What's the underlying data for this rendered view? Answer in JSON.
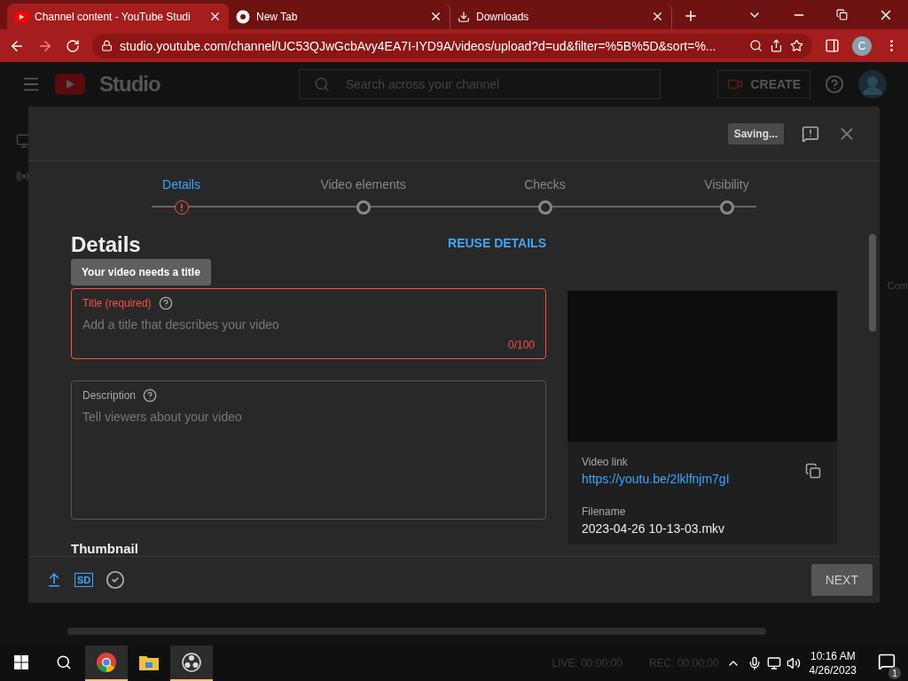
{
  "browser": {
    "tabs": [
      {
        "title": "Channel content - YouTube Studi",
        "selected": true
      },
      {
        "title": "New Tab",
        "selected": false
      },
      {
        "title": "Downloads",
        "selected": false
      }
    ],
    "url": "studio.youtube.com/channel/UC53QJwGcbAvy4EA7I-IYD9A/videos/upload?d=ud&filter=%5B%5D&sort=%...",
    "profile": "C"
  },
  "studio": {
    "logo": "Studio",
    "search_placeholder": "Search across your channel",
    "create": "CREATE",
    "side_text": "Com"
  },
  "dialog": {
    "saving": "Saving...",
    "steps": [
      {
        "label": "Details",
        "selected": true,
        "error": true
      },
      {
        "label": "Video elements",
        "selected": false,
        "error": false
      },
      {
        "label": "Checks",
        "selected": false,
        "error": false
      },
      {
        "label": "Visibility",
        "selected": false,
        "error": false
      }
    ],
    "heading": "Details",
    "tooltip": "Your video needs a title",
    "reuse": "REUSE DETAILS",
    "title_field": {
      "label": "Title (required)",
      "placeholder": "Add a title that describes your video",
      "count": "0/100",
      "error": true
    },
    "description_field": {
      "label": "Description",
      "placeholder": "Tell viewers about your video",
      "error": false
    },
    "thumbnail_heading": "Thumbnail",
    "video_link_label": "Video link",
    "video_link": "https://youtu.be/2lklfnjm7gI",
    "filename_label": "Filename",
    "filename": "2023-04-26 10-13-03.mkv",
    "sd_badge": "SD",
    "next": "NEXT"
  },
  "taskbar": {
    "live": "LIVE: 00:00:00",
    "rec": "REC: 00:00:00",
    "time": "10:16 AM",
    "date": "4/26/2023",
    "notifications": "1"
  }
}
